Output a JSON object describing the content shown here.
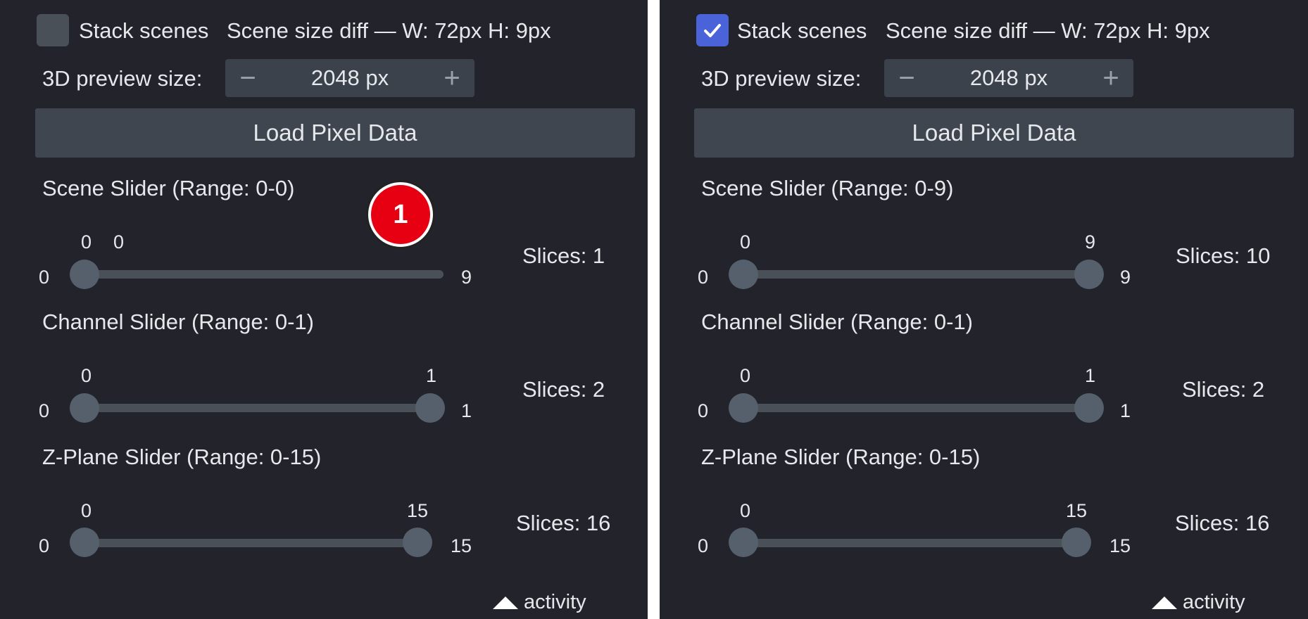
{
  "panels": [
    {
      "stack_label": "Stack scenes",
      "stack_checked": false,
      "size_diff": "Scene size diff — W: 72px  H: 9px",
      "preview_label": "3D preview size:",
      "preview_value": "2048 px",
      "minus": "−",
      "plus": "+",
      "load_label": "Load Pixel Data",
      "sliders": [
        {
          "title": "Scene Slider (Range: 0-0)",
          "min": "0",
          "max": "9",
          "low": 0,
          "high": 0,
          "low_label": "0",
          "high_label": "0",
          "slices": "Slices: 1"
        },
        {
          "title": "Channel Slider (Range: 0-1)",
          "min": "0",
          "max": "1",
          "low": 0,
          "high": 1,
          "low_label": "0",
          "high_label": "1",
          "slices": "Slices: 2"
        },
        {
          "title": "Z-Plane Slider (Range: 0-15)",
          "min": "0",
          "max": "15",
          "low": 0,
          "high": 15,
          "low_label": "0",
          "high_label": "15",
          "slices": "Slices: 16"
        }
      ],
      "activity": "activity"
    },
    {
      "stack_label": "Stack scenes",
      "stack_checked": true,
      "size_diff": "Scene size diff — W: 72px  H: 9px",
      "preview_label": "3D preview size:",
      "preview_value": "2048 px",
      "minus": "−",
      "plus": "+",
      "load_label": "Load Pixel Data",
      "sliders": [
        {
          "title": "Scene Slider (Range: 0-9)",
          "min": "0",
          "max": "9",
          "low": 0,
          "high": 9,
          "low_label": "0",
          "high_label": "9",
          "slices": "Slices: 10"
        },
        {
          "title": "Channel Slider (Range: 0-1)",
          "min": "0",
          "max": "1",
          "low": 0,
          "high": 1,
          "low_label": "0",
          "high_label": "1",
          "slices": "Slices: 2"
        },
        {
          "title": "Z-Plane Slider (Range: 0-15)",
          "min": "0",
          "max": "15",
          "low": 0,
          "high": 15,
          "low_label": "0",
          "high_label": "15",
          "slices": "Slices: 16"
        }
      ],
      "activity": "activity"
    }
  ],
  "annotation": {
    "number": "1",
    "color": "#e60012"
  },
  "colors": {
    "background": "#22232b",
    "accent": "#4a63d8",
    "control": "#3f4650"
  },
  "icons": {
    "checkbox": "checkmark-icon",
    "activity": "caret-up-icon"
  }
}
